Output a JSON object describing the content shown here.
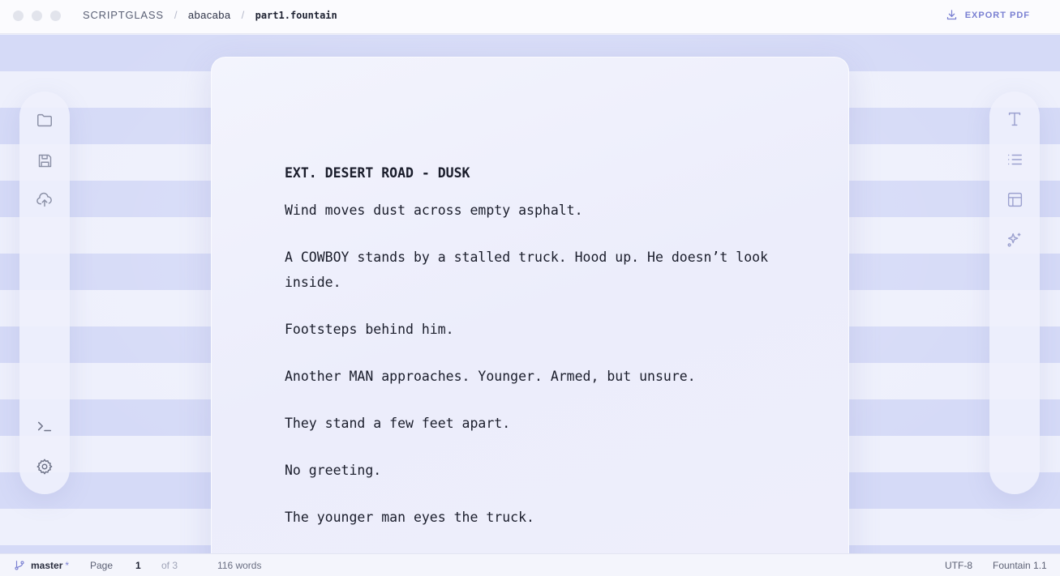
{
  "window": {
    "app_name": "SCRIPTGLASS",
    "breadcrumb": {
      "separator": "/",
      "project": "abacaba",
      "file": "part1.fountain"
    },
    "export_label": "EXPORT PDF"
  },
  "left_dock": {
    "top_icons": [
      "folder-icon",
      "save-icon",
      "cloud-upload-icon"
    ],
    "bottom_icons": [
      "terminal-icon",
      "settings-gear-icon"
    ]
  },
  "right_dock": {
    "icons": [
      "text-type-icon",
      "list-icon",
      "layout-panel-icon",
      "sparkles-icon"
    ]
  },
  "script": {
    "scene_heading": "EXT. DESERT ROAD - DUSK",
    "actions": [
      "Wind moves dust across empty asphalt.",
      "A COWBOY stands by a stalled truck. Hood up. He doesn’t look inside.",
      "Footsteps behind him.",
      "Another MAN approaches. Younger. Armed, but unsure.",
      "They stand a few feet apart.",
      "No greeting.",
      "The younger man eyes the truck."
    ]
  },
  "status_bar": {
    "branch": "master",
    "dirty_marker": "*",
    "page_label": "Page",
    "page_current": "1",
    "page_total_text": "of 3",
    "word_count": "116 words",
    "encoding": "UTF-8",
    "format": "Fountain 1.1"
  },
  "colors": {
    "accent": "#7a80d2",
    "stripe_dark": "#d5daf7",
    "stripe_light": "#eef0fc",
    "icon": "#8b90a6"
  }
}
